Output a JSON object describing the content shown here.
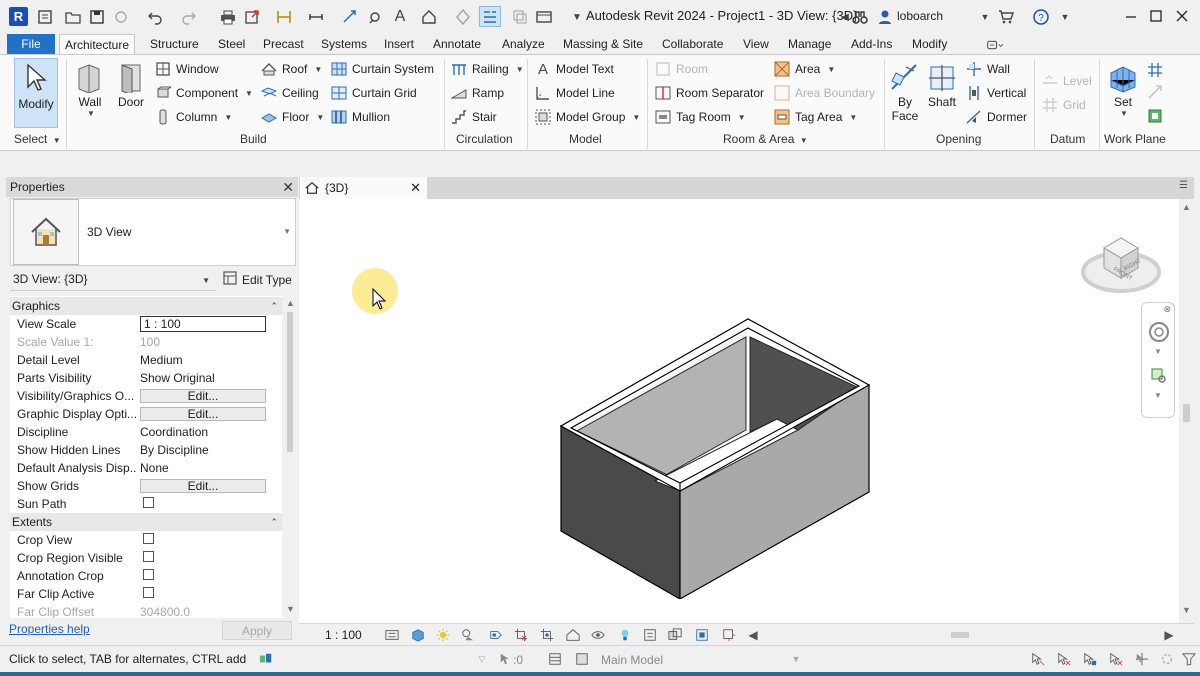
{
  "titlebar": {
    "logo_letter": "R",
    "title": "Autodesk Revit 2024 - Project1 - 3D View: {3D}",
    "user": "loboarch"
  },
  "ribbon_tabs": {
    "file": "File",
    "tabs": [
      "Architecture",
      "Structure",
      "Steel",
      "Precast",
      "Systems",
      "Insert",
      "Annotate",
      "Analyze",
      "Massing & Site",
      "Collaborate",
      "View",
      "Manage",
      "Add-Ins",
      "Modify"
    ]
  },
  "ribbon": {
    "select": {
      "modify": "Modify",
      "panel": "Select"
    },
    "build": {
      "panel": "Build",
      "wall": "Wall",
      "door": "Door",
      "window": "Window",
      "component": "Component",
      "column": "Column",
      "roof": "Roof",
      "ceiling": "Ceiling",
      "floor": "Floor",
      "curtain_system": "Curtain System",
      "curtain_grid": "Curtain Grid",
      "mullion": "Mullion"
    },
    "circulation": {
      "panel": "Circulation",
      "railing": "Railing",
      "ramp": "Ramp",
      "stair": "Stair"
    },
    "model": {
      "panel": "Model",
      "model_text": "Model Text",
      "model_line": "Model Line",
      "model_group": "Model Group"
    },
    "room_area": {
      "panel": "Room & Area",
      "room": "Room",
      "room_separator": "Room Separator",
      "tag_room": "Tag Room",
      "area": "Area",
      "area_boundary": "Area Boundary",
      "tag_area": "Tag Area"
    },
    "opening": {
      "panel": "Opening",
      "by_face_1": "By",
      "by_face_2": "Face",
      "shaft": "Shaft",
      "wall": "Wall",
      "vertical": "Vertical",
      "dormer": "Dormer"
    },
    "datum": {
      "panel": "Datum",
      "level": "Level",
      "grid": "Grid"
    },
    "work_plane": {
      "panel": "Work Plane",
      "set": "Set"
    }
  },
  "properties": {
    "title": "Properties",
    "type_name": "3D View",
    "instance_selector": "3D View: {3D}",
    "edit_type": "Edit Type",
    "groups": [
      {
        "name": "Graphics",
        "rows": [
          {
            "name": "View Scale",
            "value": "1 : 100"
          },
          {
            "name": "Scale Value    1:",
            "value": "100"
          },
          {
            "name": "Detail Level",
            "value": "Medium"
          },
          {
            "name": "Parts Visibility",
            "value": "Show Original"
          },
          {
            "name": "Visibility/Graphics O...",
            "value": "Edit..."
          },
          {
            "name": "Graphic Display Opti...",
            "value": "Edit..."
          },
          {
            "name": "Discipline",
            "value": "Coordination"
          },
          {
            "name": "Show Hidden Lines",
            "value": "By Discipline"
          },
          {
            "name": "Default Analysis Disp...",
            "value": "None"
          },
          {
            "name": "Show Grids",
            "value": "Edit..."
          },
          {
            "name": "Sun Path",
            "value": ""
          }
        ]
      },
      {
        "name": "Extents",
        "rows": [
          {
            "name": "Crop View",
            "value": ""
          },
          {
            "name": "Crop Region Visible",
            "value": ""
          },
          {
            "name": "Annotation Crop",
            "value": ""
          },
          {
            "name": "Far Clip Active",
            "value": ""
          },
          {
            "name": "Far Clip Offset",
            "value": "304800.0"
          }
        ]
      }
    ],
    "help_link": "Properties help",
    "apply": "Apply"
  },
  "view": {
    "tab_title": "{3D}",
    "scale": "1 : 100"
  },
  "viewcube": {
    "front_label": "FRONT",
    "right_label": "RIGHT"
  },
  "statusbar": {
    "hint": "Click to select, TAB for alternates, CTRL adds, SHIFT unselects.",
    "selection_count": ":0",
    "model": "Main Model"
  },
  "colors": {
    "file_tab": "#2370c7",
    "wall_dark": "#4a4a4a",
    "wall_mid": "#a9a9a9",
    "wall_light": "#c4c4c4",
    "cursor_highlight": "#fae982"
  }
}
